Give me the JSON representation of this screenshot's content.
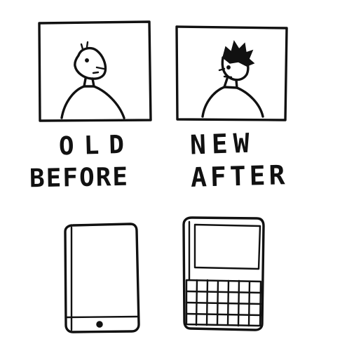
{
  "captions": {
    "old": "OLD",
    "before": "BEFORE",
    "new": "NEW",
    "after": "AFTER"
  },
  "panels": [
    {
      "id": "old-before",
      "depicts": "person-short-hair"
    },
    {
      "id": "new-after",
      "depicts": "person-spiky-hair"
    }
  ],
  "devices": [
    {
      "id": "old-phone",
      "icon": "touchscreen-phone-icon"
    },
    {
      "id": "new-phone",
      "icon": "keyboard-phone-icon"
    }
  ],
  "colors": {
    "ink": "#111111",
    "paper": "#ffffff"
  }
}
